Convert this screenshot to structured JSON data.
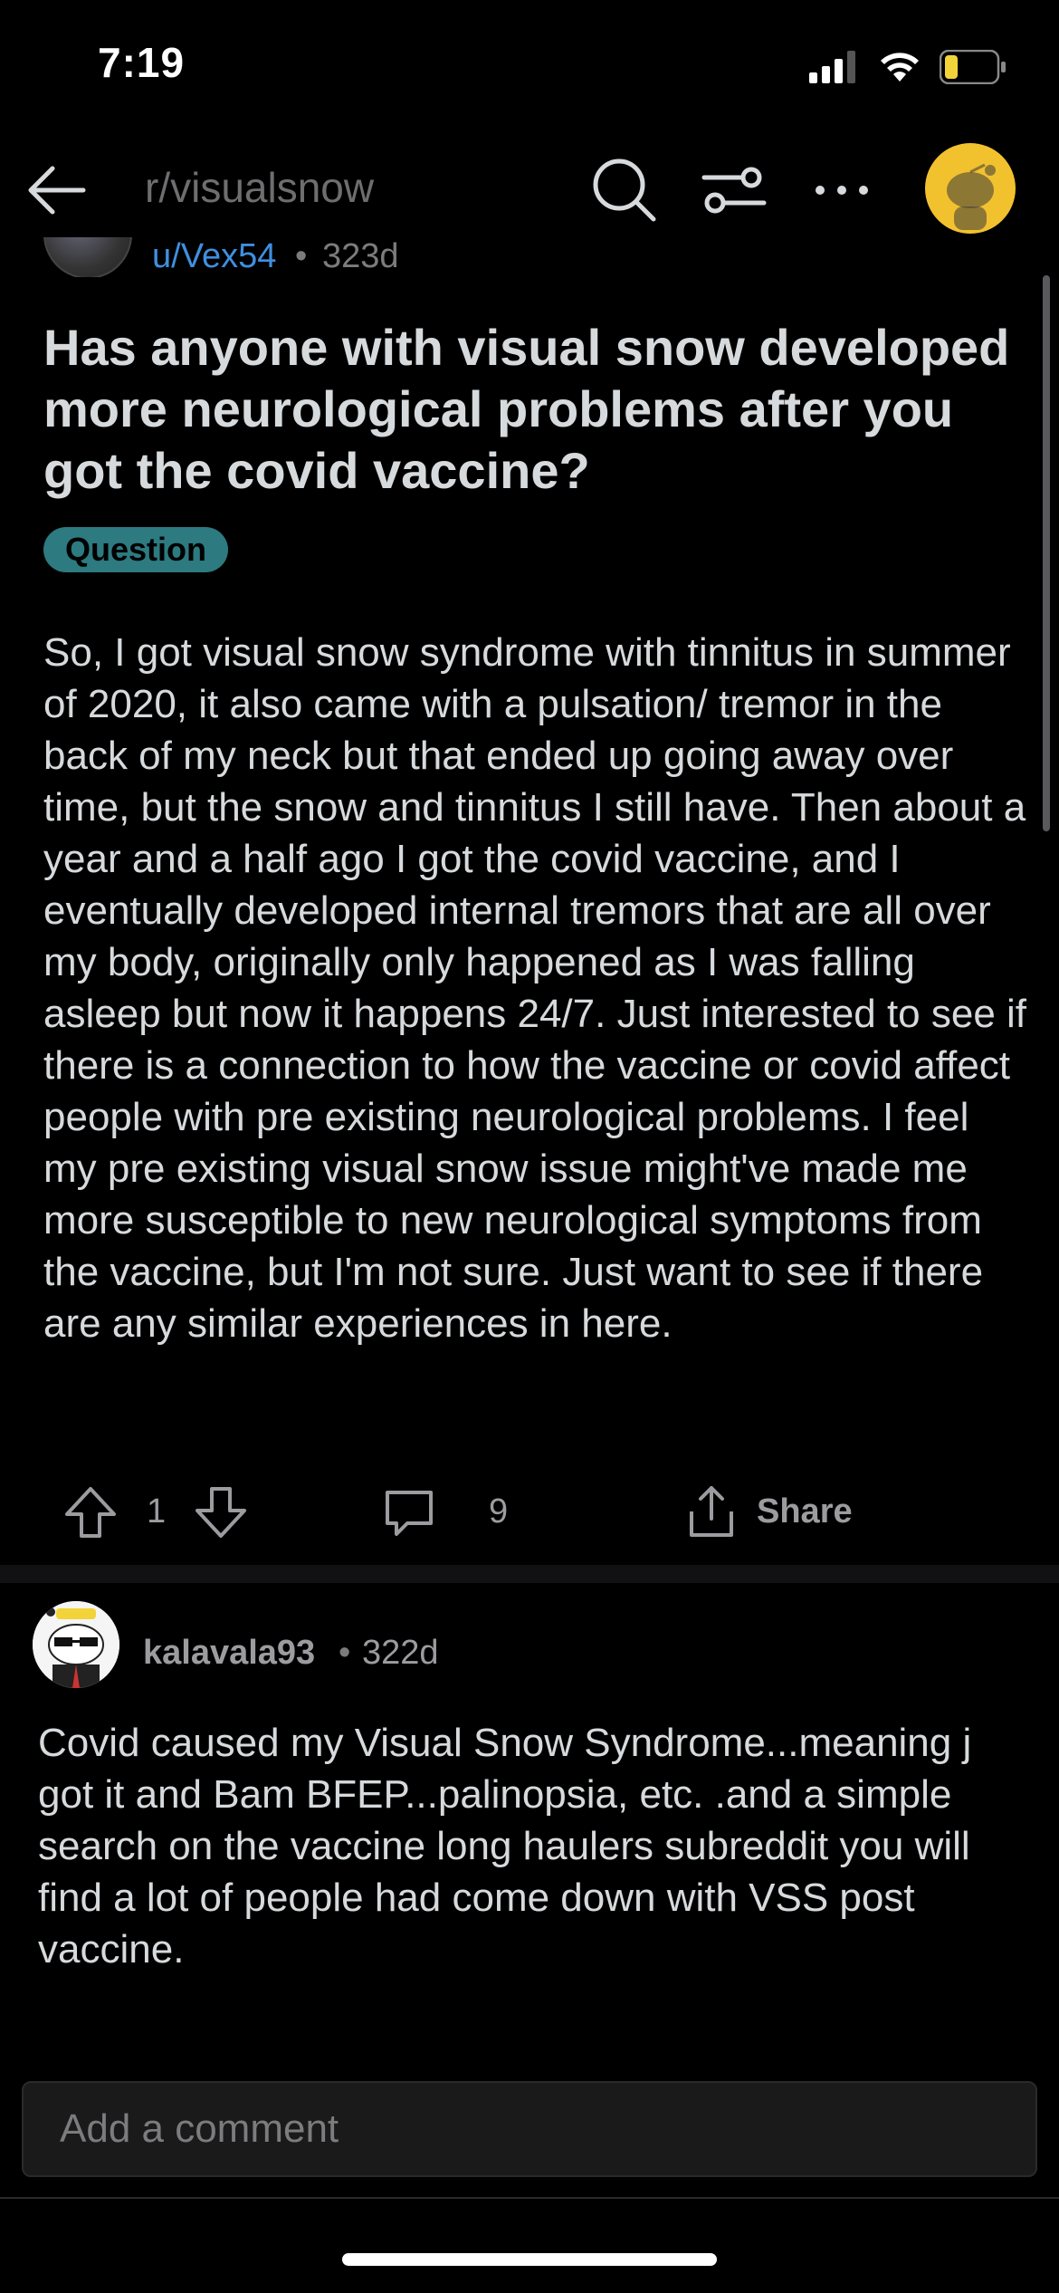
{
  "status_bar": {
    "time": "7:19"
  },
  "nav": {
    "subreddit": "r/visualsnow"
  },
  "post": {
    "author": "u/Vex54",
    "separator": "•",
    "age": "323d",
    "title": "Has anyone with visual snow developed more neurological problems after you got the covid vaccine?",
    "flair": "Question",
    "body": "So, I got visual snow syndrome with tinnitus in summer of 2020, it also came with a pulsation/ tremor in the back of my neck but that ended up going away over time, but the snow and tinnitus I still have. Then about a year and a half ago I got the covid vaccine, and I eventually developed internal tremors that are all over my body, originally only happened as I was falling asleep but now it happens 24/7. Just interested to see if there is a connection to how the vaccine or covid affect people with pre existing neurological problems. I feel my pre existing visual snow issue might've made me more susceptible to new neurological symptoms from the vaccine, but I'm not sure. Just want to see if there are any similar experiences in here.",
    "votes": "1",
    "comments": "9",
    "share_label": "Share"
  },
  "comment": {
    "author": "kalavala93",
    "separator": "•",
    "age": "322d",
    "body": "Covid caused my Visual Snow Syndrome...meaning j got it and Bam BFEP...palinopsia, etc. .and a simple search on the vaccine long haulers subreddit you will find a lot of people had come down with VSS post vaccine."
  },
  "composer": {
    "placeholder": "Add a comment"
  },
  "icons": {
    "back": "back-arrow-icon",
    "search": "search-icon",
    "filter": "sort-filter-icon",
    "more": "more-icon",
    "upvote": "upvote-icon",
    "downvote": "downvote-icon",
    "comment": "comment-icon",
    "share": "share-icon"
  },
  "colors": {
    "background": "#000000",
    "text": "#d7dadc",
    "username_link": "#3f8fe0",
    "flair_bg": "#2d7a80",
    "avatar_bg": "#f2c12e",
    "muted": "#9c9ca0"
  }
}
